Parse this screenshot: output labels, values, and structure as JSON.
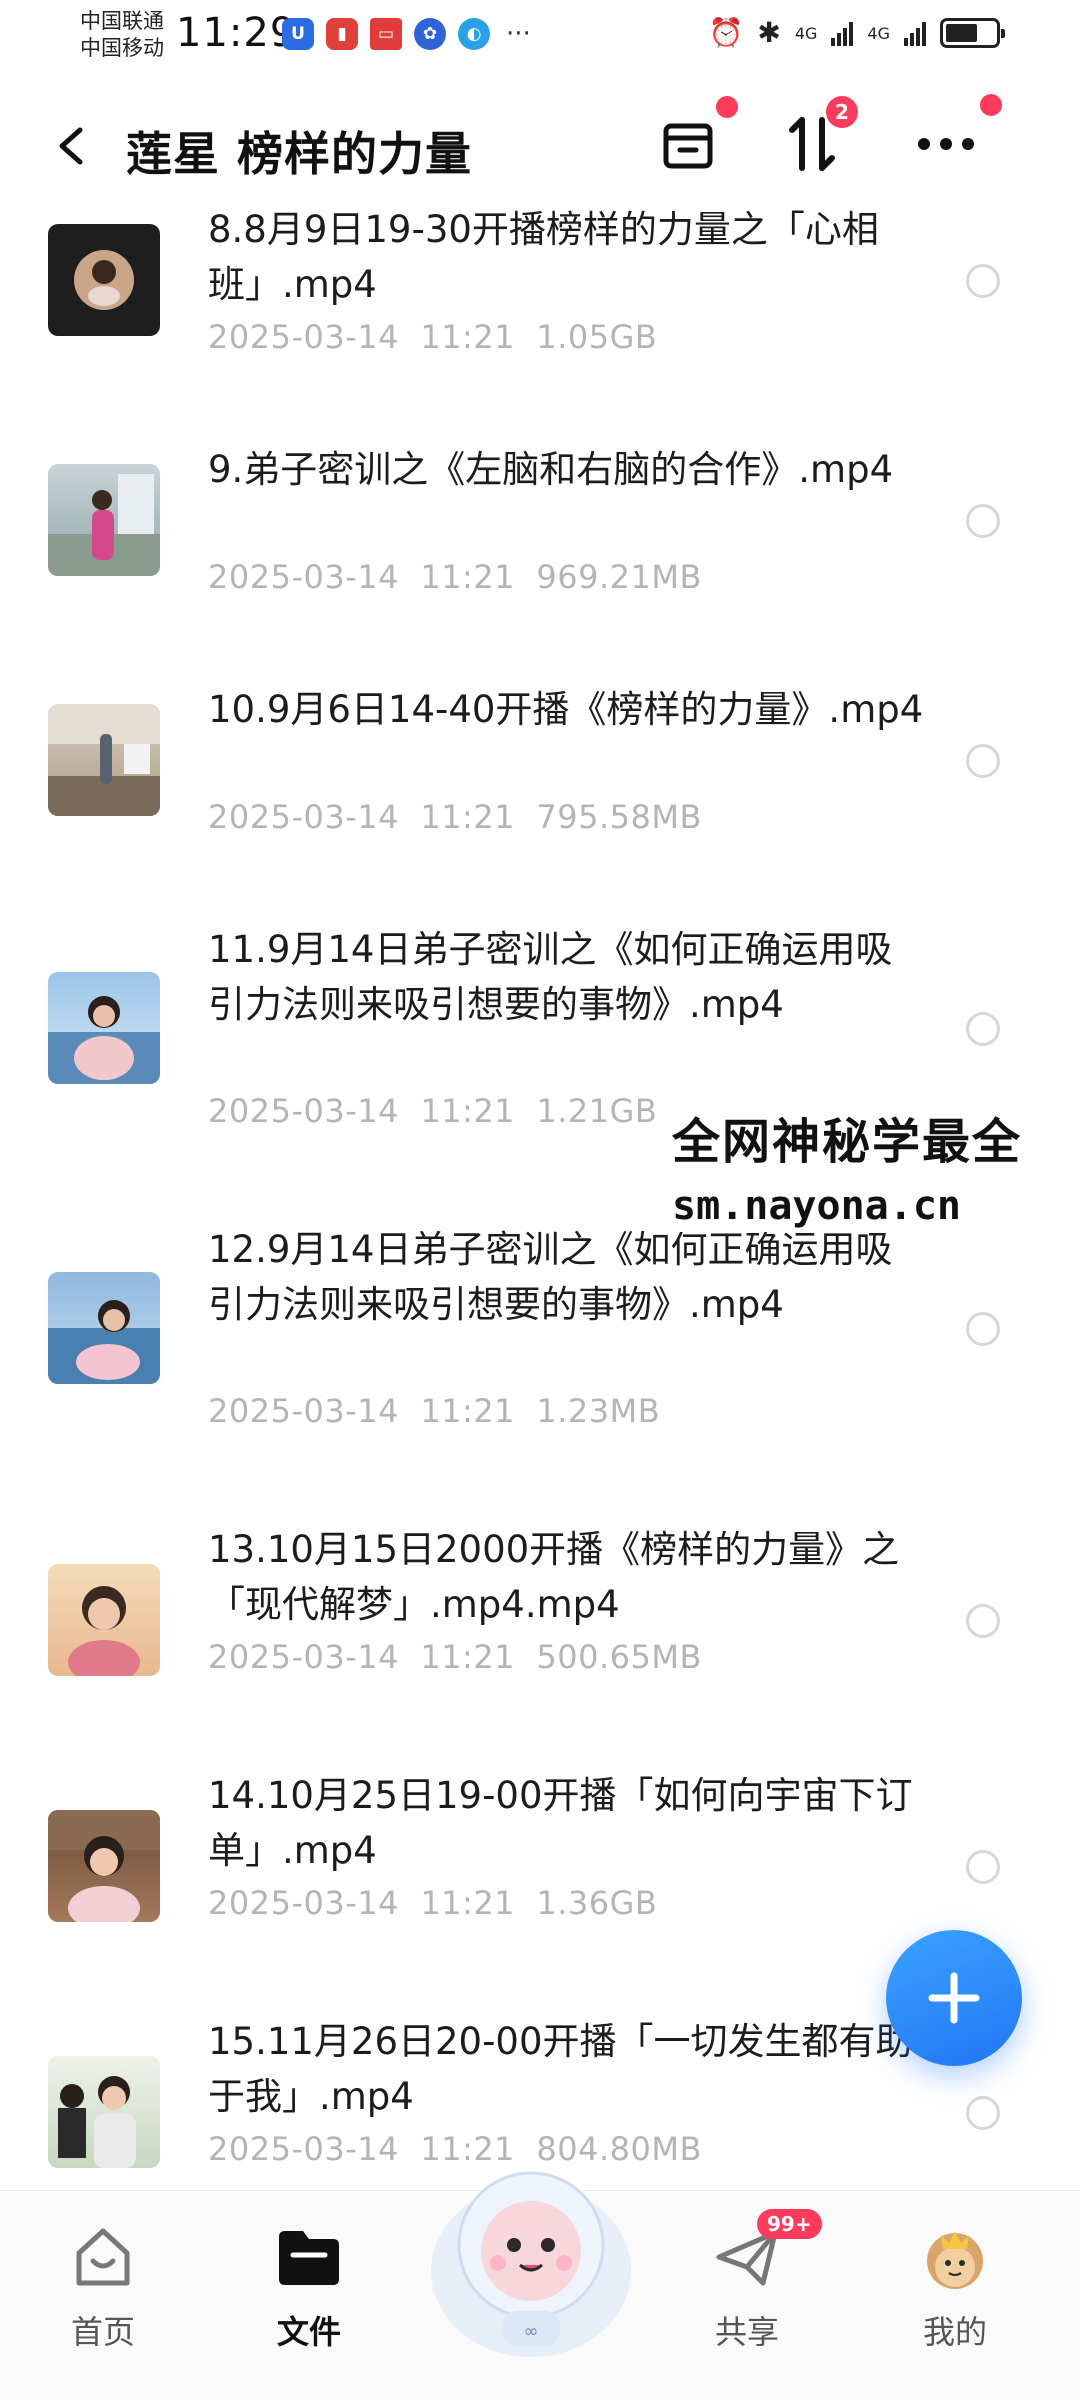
{
  "status_bar": {
    "carrier_1": "中国联通",
    "carrier_2": "中国移动",
    "time": "11:29",
    "network_1": "4G",
    "network_2": "4G",
    "battery_level": 0.65
  },
  "header": {
    "title": "莲星 榜样的力量",
    "sort_badge": "2",
    "icons": [
      "back-icon",
      "archive-icon",
      "sort-icon",
      "more-icon"
    ]
  },
  "files": [
    {
      "name": "8.8月9日19-30开播榜样的力量之「心相班」.mp4",
      "date": "2025-03-14",
      "time": "11:21",
      "size": "1.05GB"
    },
    {
      "name": "9.弟子密训之《左脑和右脑的合作》.mp4",
      "date": "2025-03-14",
      "time": "11:21",
      "size": "969.21MB"
    },
    {
      "name": "10.9月6日14-40开播《榜样的力量》.mp4",
      "date": "2025-03-14",
      "time": "11:21",
      "size": "795.58MB"
    },
    {
      "name": "11.9月14日弟子密训之《如何正确运用吸引力法则来吸引想要的事物》.mp4",
      "date": "2025-03-14",
      "time": "11:21",
      "size": "1.21GB"
    },
    {
      "name": "12.9月14日弟子密训之《如何正确运用吸引力法则来吸引想要的事物》.mp4",
      "date": "2025-03-14",
      "time": "11:21",
      "size": "1.23MB"
    },
    {
      "name": "13.10月15日2000开播《榜样的力量》之「现代解梦」.mp4.mp4",
      "date": "2025-03-14",
      "time": "11:21",
      "size": "500.65MB"
    },
    {
      "name": "14.10月25日19-00开播「如何向宇宙下订单」.mp4",
      "date": "2025-03-14",
      "time": "11:21",
      "size": "1.36GB"
    },
    {
      "name": "15.11月26日20-00开播「一切发生都有助于我」.mp4",
      "date": "2025-03-14",
      "time": "11:21",
      "size": "804.80MB"
    }
  ],
  "watermark": {
    "line_1": "全网神秘学最全",
    "line_2": "sm.nayona.cn"
  },
  "bottom_nav": {
    "home": "首页",
    "files": "文件",
    "share": "共享",
    "share_badge": "99+",
    "mine": "我的"
  },
  "colors": {
    "accent": "#2276f5",
    "badge": "#ff3b5c",
    "meta_text": "#b4b4b8"
  }
}
